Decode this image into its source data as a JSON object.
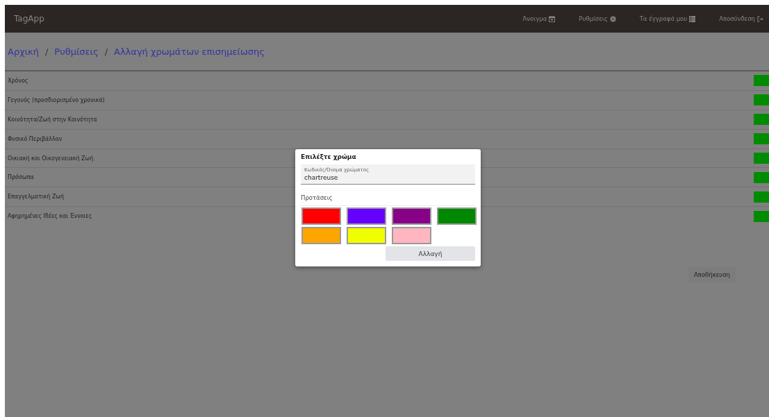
{
  "navbar": {
    "brand": "TagApp",
    "links": [
      {
        "label": "Άνοιγμα"
      },
      {
        "label": "Ρυθμίσεις"
      },
      {
        "label": "Τα έγγραφά μου"
      },
      {
        "label": "Αποσύνδεση"
      }
    ]
  },
  "breadcrumb": {
    "separator": "/",
    "items": [
      "Αρχική",
      "Ρυθμίσεις",
      "Αλλαγή χρωμάτων επισημείωσης"
    ]
  },
  "tags": [
    {
      "name": "Χρόνος",
      "color": "#008c00"
    },
    {
      "name": "Γεγονός (προσδιορισμένο χρονικά)",
      "color": "#008c00"
    },
    {
      "name": "Κοινότητα/Ζωή στην Κοινότητα",
      "color": "#008c00"
    },
    {
      "name": "Φυσικό Περιβάλλον",
      "color": "#008c00"
    },
    {
      "name": "Οικιακή και Οικογενειακή Ζωή",
      "color": "#008c00"
    },
    {
      "name": "Πρόσωπα",
      "color": "#008c00"
    },
    {
      "name": "Επαγγελματική Ζωή",
      "color": "#008c00"
    },
    {
      "name": "Αφηρημένες Ιδέες και Έννοιες",
      "color": "#008c00"
    }
  ],
  "save_button": "Αποθήκευση",
  "dialog": {
    "title": "Επιλέξτε χρώμα",
    "field": {
      "label": "Κωδικός/Όνομα χρώματος",
      "value": "chartreuse"
    },
    "suggestions_label": "Προτάσεις",
    "swatches": [
      {
        "color": "#ff0000"
      },
      {
        "color": "#6600ff"
      },
      {
        "color": "#880088"
      },
      {
        "color": "#008800"
      },
      {
        "color": "#ffa500"
      },
      {
        "color": "#f0ff00"
      },
      {
        "color": "#ffb6c1"
      }
    ],
    "button": "Αλλαγή"
  }
}
